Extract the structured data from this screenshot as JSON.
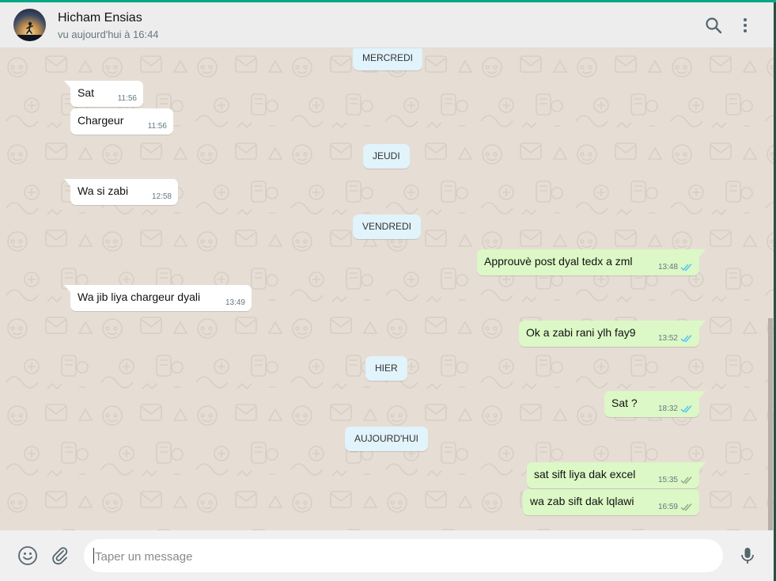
{
  "header": {
    "contact_name": "Hicham Ensias",
    "contact_status": "vu aujourd'hui à 16:44",
    "icons": [
      "search-icon",
      "menu-icon"
    ]
  },
  "chat": {
    "dates": [
      "MERCREDI",
      "JEUDI",
      "VENDREDI",
      "HIER",
      "AUJOURD'HUI"
    ],
    "messages": [
      {
        "text": "Sat",
        "time": "11:56",
        "direction": "in"
      },
      {
        "text": "Chargeur",
        "time": "11:56",
        "direction": "in"
      },
      {
        "text": "Wa si zabi",
        "time": "12:58",
        "direction": "in"
      },
      {
        "text": "Approuvè post dyal tedx a zml",
        "time": "13:48",
        "direction": "out",
        "status": "read"
      },
      {
        "text": "Wa jib liya chargeur dyali",
        "time": "13:49",
        "direction": "in"
      },
      {
        "text": "Ok a zabi rani ylh fay9",
        "time": "13:52",
        "direction": "out",
        "status": "read"
      },
      {
        "text": "Sat ?",
        "time": "18:32",
        "direction": "out",
        "status": "read"
      },
      {
        "text": "sat sift liya dak excel",
        "time": "15:35",
        "direction": "out",
        "status": "delivered"
      },
      {
        "text": "wa zab sift dak lqlawi",
        "time": "16:59",
        "direction": "out",
        "status": "delivered"
      }
    ]
  },
  "footer": {
    "placeholder": "Taper un message",
    "icons": [
      "emoji-icon",
      "attach-icon",
      "mic-icon"
    ]
  },
  "colors": {
    "accent": "#00a884",
    "outgoing_bubble": "#dcf8c6",
    "incoming_bubble": "#ffffff",
    "date_pill": "#e1f3fb",
    "read_tick": "#4fc3f7",
    "delivered_tick": "#92a58c",
    "chat_background": "#e6ded5"
  }
}
